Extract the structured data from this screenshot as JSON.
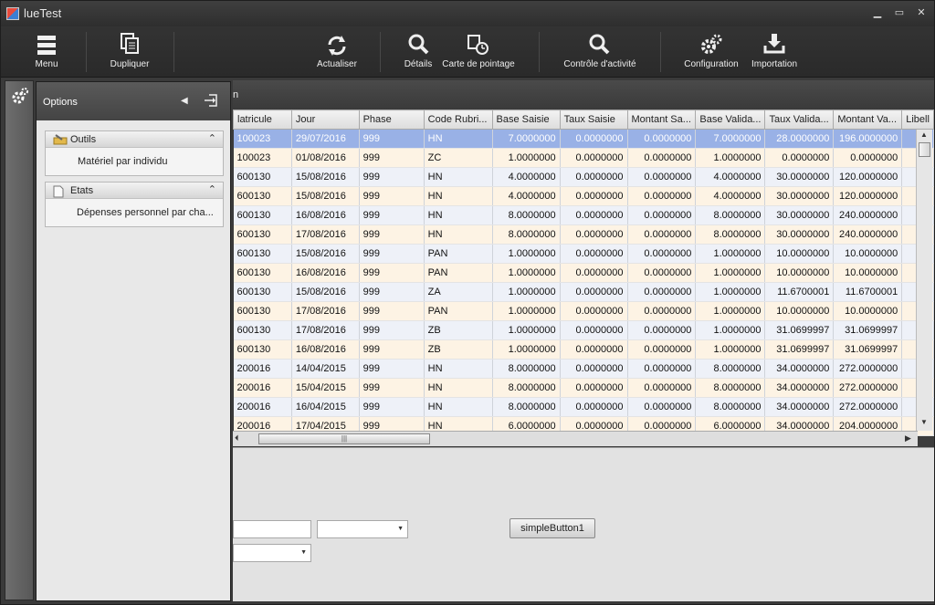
{
  "window": {
    "title": "lueTest",
    "min": "▁",
    "max": "▭",
    "close": "✕"
  },
  "toolbar": {
    "items": [
      {
        "label": "Menu",
        "icon": "hamburger-icon"
      },
      {
        "label": "Dupliquer",
        "icon": "duplicate-icon"
      },
      {
        "label": "Actualiser",
        "icon": "refresh-icon"
      },
      {
        "label": "Détails",
        "icon": "magnifier-icon"
      },
      {
        "label": "Carte de pointage",
        "icon": "timecard-icon"
      },
      {
        "label": "Contrôle d'activité",
        "icon": "magnifier-icon"
      },
      {
        "label": "Configuration",
        "icon": "gears-icon"
      },
      {
        "label": "Importation",
        "icon": "import-icon"
      }
    ]
  },
  "options_panel": {
    "title": "Options",
    "collapse_glyph": "◀",
    "groups": [
      {
        "title": "Outils",
        "collapse_glyph": "⌃",
        "items": [
          "Matériel par individu"
        ]
      },
      {
        "title": "Etats",
        "collapse_glyph": "⌃",
        "items": [
          "Dépenses personnel par cha..."
        ]
      }
    ]
  },
  "grid": {
    "caption_fragment": "n",
    "columns": [
      "latricule",
      "Jour",
      "Phase",
      "Code Rubri...",
      "Base Saisie",
      "Taux Saisie",
      "Montant Sa...",
      "Base Valida...",
      "Taux Valida...",
      "Montant Va...",
      "Libell"
    ],
    "rows": [
      [
        "100023",
        "29/07/2016",
        "999",
        "HN",
        "7.0000000",
        "0.0000000",
        "0.0000000",
        "7.0000000",
        "28.0000000",
        "196.0000000",
        ""
      ],
      [
        "100023",
        "01/08/2016",
        "999",
        "ZC",
        "1.0000000",
        "0.0000000",
        "0.0000000",
        "1.0000000",
        "0.0000000",
        "0.0000000",
        ""
      ],
      [
        "600130",
        "15/08/2016",
        "999",
        "HN",
        "4.0000000",
        "0.0000000",
        "0.0000000",
        "4.0000000",
        "30.0000000",
        "120.0000000",
        ""
      ],
      [
        "600130",
        "15/08/2016",
        "999",
        "HN",
        "4.0000000",
        "0.0000000",
        "0.0000000",
        "4.0000000",
        "30.0000000",
        "120.0000000",
        ""
      ],
      [
        "600130",
        "16/08/2016",
        "999",
        "HN",
        "8.0000000",
        "0.0000000",
        "0.0000000",
        "8.0000000",
        "30.0000000",
        "240.0000000",
        ""
      ],
      [
        "600130",
        "17/08/2016",
        "999",
        "HN",
        "8.0000000",
        "0.0000000",
        "0.0000000",
        "8.0000000",
        "30.0000000",
        "240.0000000",
        ""
      ],
      [
        "600130",
        "15/08/2016",
        "999",
        "PAN",
        "1.0000000",
        "0.0000000",
        "0.0000000",
        "1.0000000",
        "10.0000000",
        "10.0000000",
        ""
      ],
      [
        "600130",
        "16/08/2016",
        "999",
        "PAN",
        "1.0000000",
        "0.0000000",
        "0.0000000",
        "1.0000000",
        "10.0000000",
        "10.0000000",
        ""
      ],
      [
        "600130",
        "15/08/2016",
        "999",
        "ZA",
        "1.0000000",
        "0.0000000",
        "0.0000000",
        "1.0000000",
        "11.6700001",
        "11.6700001",
        ""
      ],
      [
        "600130",
        "17/08/2016",
        "999",
        "PAN",
        "1.0000000",
        "0.0000000",
        "0.0000000",
        "1.0000000",
        "10.0000000",
        "10.0000000",
        ""
      ],
      [
        "600130",
        "17/08/2016",
        "999",
        "ZB",
        "1.0000000",
        "0.0000000",
        "0.0000000",
        "1.0000000",
        "31.0699997",
        "31.0699997",
        ""
      ],
      [
        "600130",
        "16/08/2016",
        "999",
        "ZB",
        "1.0000000",
        "0.0000000",
        "0.0000000",
        "1.0000000",
        "31.0699997",
        "31.0699997",
        ""
      ],
      [
        "200016",
        "14/04/2015",
        "999",
        "HN",
        "8.0000000",
        "0.0000000",
        "0.0000000",
        "8.0000000",
        "34.0000000",
        "272.0000000",
        ""
      ],
      [
        "200016",
        "15/04/2015",
        "999",
        "HN",
        "8.0000000",
        "0.0000000",
        "0.0000000",
        "8.0000000",
        "34.0000000",
        "272.0000000",
        ""
      ],
      [
        "200016",
        "16/04/2015",
        "999",
        "HN",
        "8.0000000",
        "0.0000000",
        "0.0000000",
        "8.0000000",
        "34.0000000",
        "272.0000000",
        ""
      ],
      [
        "200016",
        "17/04/2015",
        "999",
        "HN",
        "6.0000000",
        "0.0000000",
        "0.0000000",
        "6.0000000",
        "34.0000000",
        "204.0000000",
        ""
      ]
    ],
    "selected_row": 0
  },
  "form": {
    "text1_value": "",
    "combo1_value": "",
    "combo2_value": "",
    "button_label": "simpleButton1"
  },
  "colors": {
    "accent_selection": "#99b1e6",
    "row_even": "#eef1f8",
    "row_odd": "#fdf3e4"
  }
}
